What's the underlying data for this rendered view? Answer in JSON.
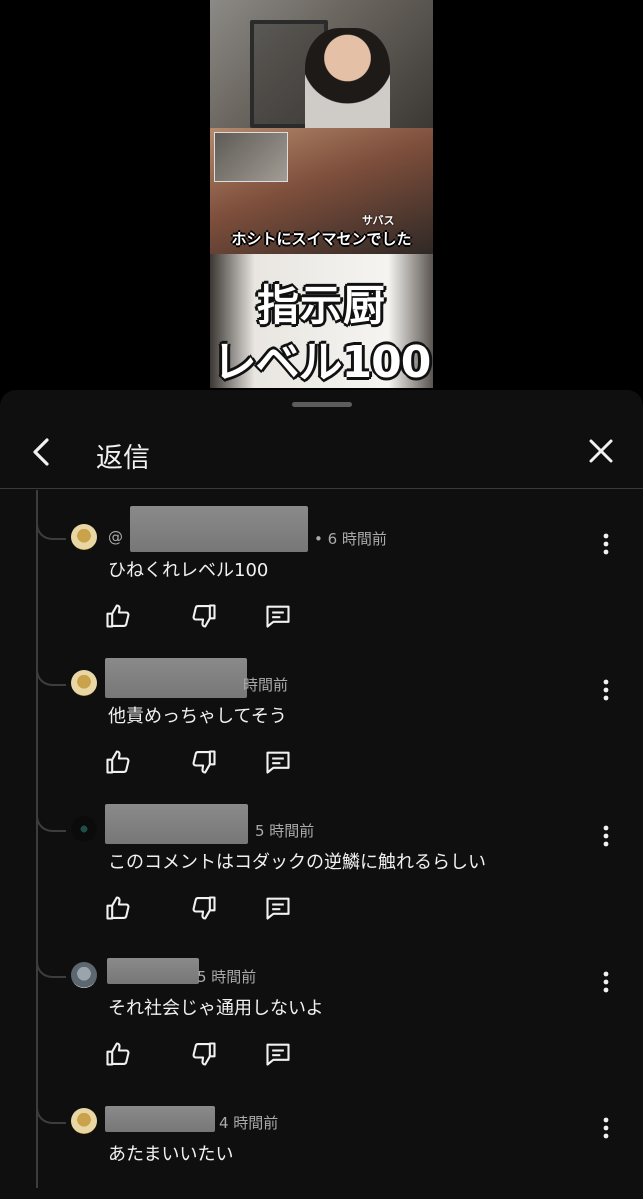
{
  "video": {
    "caption": "ホシトにスイマセンでした",
    "small_label": "サバス",
    "big_line1": "指示厨",
    "big_line2": "レベル100"
  },
  "sheet": {
    "title": "返信"
  },
  "comments": [
    {
      "handle_prefix": "@",
      "time": "• 6 時間前",
      "text": "ひねくれレベル100",
      "avatar": "avatar-yellow"
    },
    {
      "time": "時間前",
      "text": "他責めっちゃしてそう",
      "avatar": "avatar-yellow"
    },
    {
      "time": "5 時間前",
      "text": "このコメントはコダックの逆鱗に触れるらしい",
      "avatar": "avatar-dark"
    },
    {
      "time": "5 時間前",
      "text": "それ社会じゃ通用しないよ",
      "avatar": "avatar-gray"
    },
    {
      "time": "4 時間前",
      "text": "あたまいいたい",
      "avatar": "avatar-yellow"
    }
  ],
  "icons": {
    "back": "chevron-left-icon",
    "close": "close-icon",
    "like": "thumbs-up-icon",
    "dislike": "thumbs-down-icon",
    "reply": "reply-comment-icon",
    "more": "more-vertical-icon"
  }
}
